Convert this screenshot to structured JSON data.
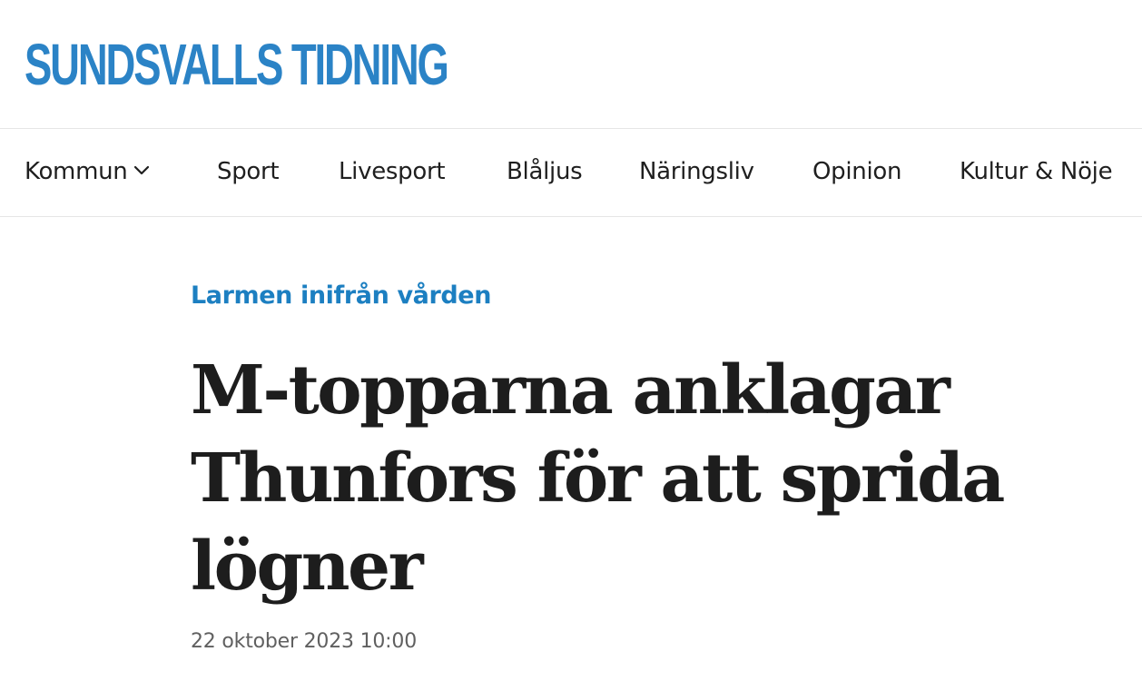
{
  "site": {
    "logo_text": "SUNDSVALLS TIDNING",
    "brand_color": "#2b83c6"
  },
  "nav": {
    "items": [
      {
        "label": "Kommun",
        "has_dropdown": true,
        "icon": "chevron-down-icon"
      },
      {
        "label": "Sport"
      },
      {
        "label": "Livesport"
      },
      {
        "label": "Blåljus"
      },
      {
        "label": "Näringsliv"
      },
      {
        "label": "Opinion"
      },
      {
        "label": "Kultur & Nöje"
      }
    ]
  },
  "article": {
    "kicker": "Larmen inifrån vården",
    "kicker_color": "#1c7fc1",
    "headline_lines": [
      "M-topparna anklagar",
      "Thunfors för att sprida",
      "lögner"
    ],
    "published": "22 oktober 2023 10:00"
  }
}
